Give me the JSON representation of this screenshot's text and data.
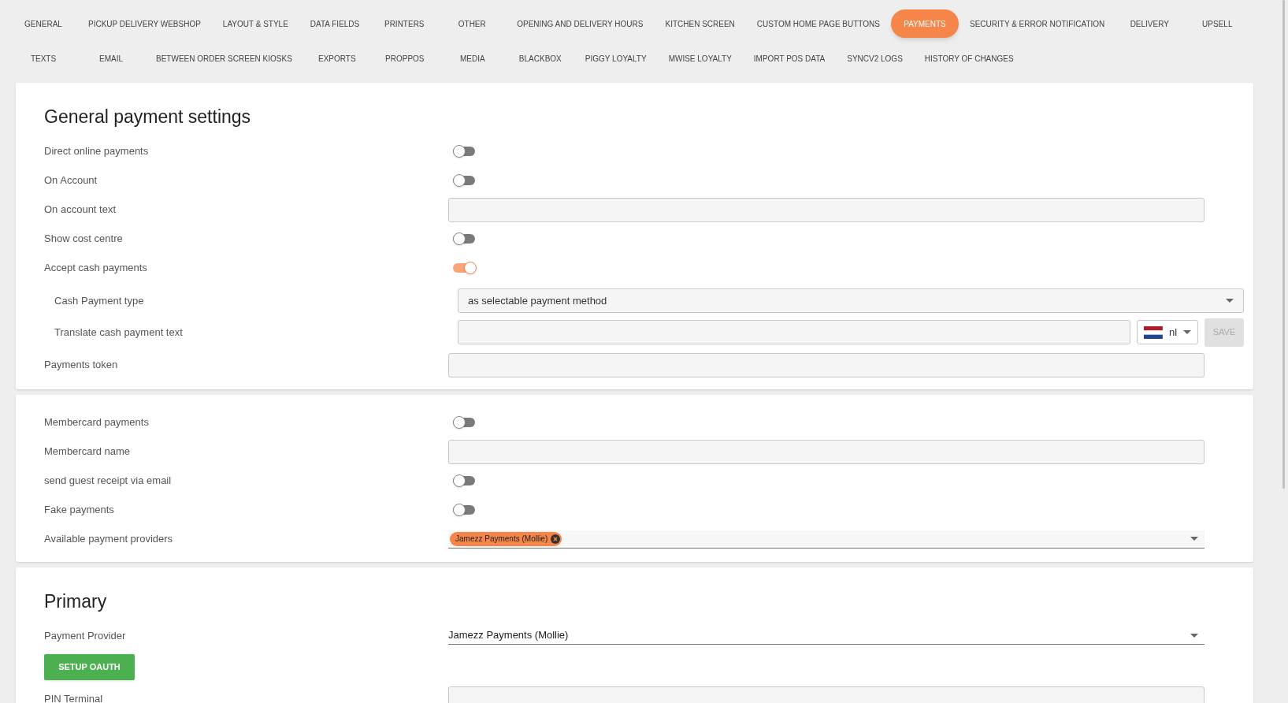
{
  "tab_rows": [
    [
      {
        "label": "GENERAL",
        "selected": false
      },
      {
        "label": "PICKUP DELIVERY WEBSHOP",
        "selected": false
      },
      {
        "label": "LAYOUT & STYLE",
        "selected": false
      },
      {
        "label": "DATA FIELDS",
        "selected": false
      },
      {
        "label": "PRINTERS",
        "selected": false
      },
      {
        "label": "OTHER",
        "selected": false
      },
      {
        "label": "OPENING AND DELIVERY HOURS",
        "selected": false
      },
      {
        "label": "KITCHEN SCREEN",
        "selected": false
      },
      {
        "label": "CUSTOM HOME PAGE BUTTONS",
        "selected": false
      },
      {
        "label": "PAYMENTS",
        "selected": true
      },
      {
        "label": "SECURITY & ERROR NOTIFICATION",
        "selected": false
      },
      {
        "label": "DELIVERY",
        "selected": false
      },
      {
        "label": "UPSELL",
        "selected": false
      }
    ],
    [
      {
        "label": "TEXTS",
        "selected": false
      },
      {
        "label": "EMAIL",
        "selected": false
      },
      {
        "label": "BETWEEN ORDER SCREEN KIOSKS",
        "selected": false
      },
      {
        "label": "EXPORTS",
        "selected": false
      },
      {
        "label": "PROPPOS",
        "selected": false
      },
      {
        "label": "MEDIA",
        "selected": false
      },
      {
        "label": "BLACKBOX",
        "selected": false
      },
      {
        "label": "PIGGY LOYALTY",
        "selected": false
      },
      {
        "label": "MWISE LOYALTY",
        "selected": false
      },
      {
        "label": "IMPORT POS DATA",
        "selected": false
      },
      {
        "label": "SYNCV2 LOGS",
        "selected": false
      },
      {
        "label": "HISTORY OF CHANGES",
        "selected": false
      }
    ]
  ],
  "sections": [
    {
      "title": "General payment settings",
      "rows": [
        {
          "kind": "toggle",
          "label": "Direct online payments",
          "on": false
        },
        {
          "kind": "toggle",
          "label": "On Account",
          "on": false
        },
        {
          "kind": "text",
          "label": "On account text"
        },
        {
          "kind": "toggle",
          "label": "Show cost centre",
          "on": false
        },
        {
          "kind": "toggle",
          "label": "Accept cash payments",
          "on": true,
          "children": [
            {
              "kind": "select",
              "label": "Cash Payment type",
              "value": "as selectable payment method"
            },
            {
              "kind": "translate",
              "label": "Translate cash payment text",
              "language": "nl",
              "button": "SAVE"
            }
          ]
        },
        {
          "kind": "text",
          "label": "Payments token"
        }
      ]
    },
    {
      "rows": [
        {
          "kind": "toggle",
          "label": "Membercard payments",
          "on": false
        },
        {
          "kind": "text",
          "label": "Membercard name"
        },
        {
          "kind": "toggle",
          "label": "send guest receipt via email",
          "on": false
        },
        {
          "kind": "toggle",
          "label": "Fake payments",
          "on": false
        },
        {
          "kind": "chips",
          "label": "Available payment providers",
          "chips": [
            "Jamezz Payments (Mollie)"
          ]
        }
      ]
    },
    {
      "title": "Primary",
      "rows": [
        {
          "kind": "underline",
          "label": "Payment Provider",
          "value": "Jamezz Payments (Mollie)"
        },
        {
          "kind": "button",
          "label": "SETUP OAUTH"
        },
        {
          "kind": "text",
          "label": "PIN Terminal"
        }
      ]
    }
  ]
}
